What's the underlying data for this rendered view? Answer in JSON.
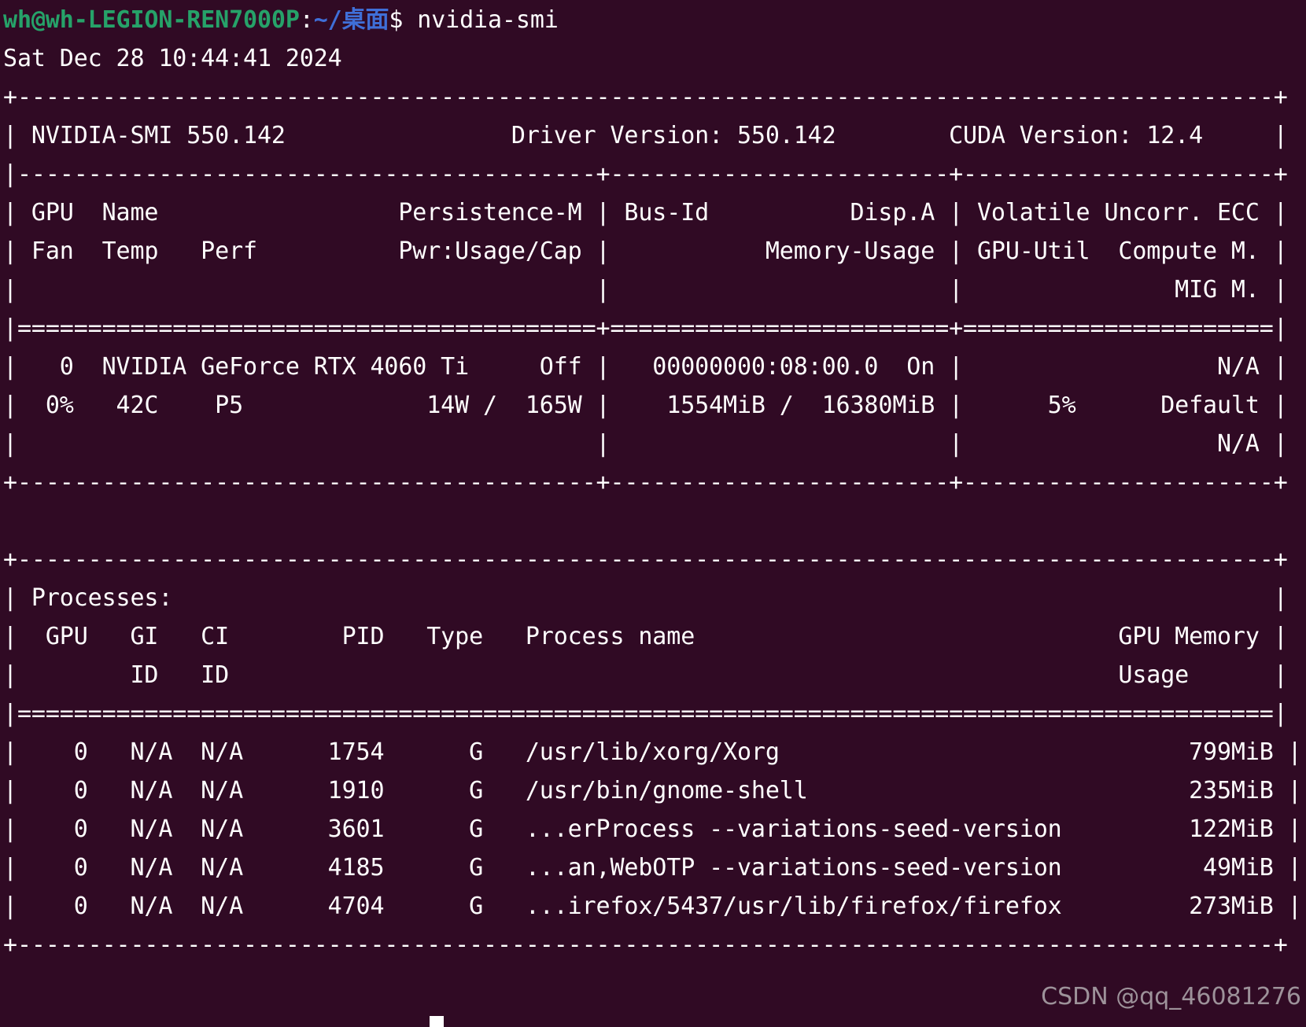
{
  "prompt": {
    "user_host": "wh@wh-LEGION-REN7000P",
    "colon": ":",
    "path": "~/桌面",
    "dollar": "$ ",
    "command": "nvidia-smi"
  },
  "output_lines": [
    "Sat Dec 28 10:44:41 2024",
    "+-----------------------------------------------------------------------------------------+",
    "| NVIDIA-SMI 550.142                Driver Version: 550.142        CUDA Version: 12.4     |",
    "|-----------------------------------------+------------------------+----------------------+",
    "| GPU  Name                 Persistence-M | Bus-Id          Disp.A | Volatile Uncorr. ECC |",
    "| Fan  Temp   Perf          Pwr:Usage/Cap |           Memory-Usage | GPU-Util  Compute M. |",
    "|                                         |                        |               MIG M. |",
    "|=========================================+========================+======================|",
    "|   0  NVIDIA GeForce RTX 4060 Ti     Off |   00000000:08:00.0  On |                  N/A |",
    "|  0%   42C    P5             14W /  165W |    1554MiB /  16380MiB |      5%      Default |",
    "|                                         |                        |                  N/A |",
    "+-----------------------------------------+------------------------+----------------------+",
    "",
    "+-----------------------------------------------------------------------------------------+",
    "| Processes:                                                                              |",
    "|  GPU   GI   CI        PID   Type   Process name                              GPU Memory |",
    "|        ID   ID                                                               Usage      |",
    "|=========================================================================================|",
    "|    0   N/A  N/A      1754      G   /usr/lib/xorg/Xorg                             799MiB |",
    "|    0   N/A  N/A      1910      G   /usr/bin/gnome-shell                           235MiB |",
    "|    0   N/A  N/A      3601      G   ...erProcess --variations-seed-version         122MiB |",
    "|    0   N/A  N/A      4185      G   ...an,WebOTP --variations-seed-version          49MiB |",
    "|    0   N/A  N/A      4704      G   ...irefox/5437/usr/lib/firefox/firefox         273MiB |",
    "+-----------------------------------------------------------------------------------------+"
  ],
  "watermark": "CSDN @qq_46081276"
}
